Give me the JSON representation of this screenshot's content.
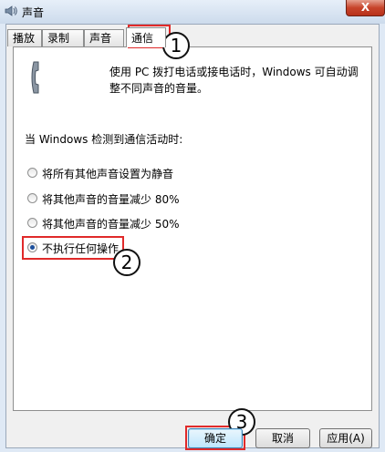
{
  "window": {
    "title": "声音",
    "close_label": "X"
  },
  "tabs": [
    {
      "label": "播放",
      "active": false
    },
    {
      "label": "录制",
      "active": false
    },
    {
      "label": "声音",
      "active": false
    },
    {
      "label": "通信",
      "active": true
    }
  ],
  "communications": {
    "description": "使用 PC 拨打电话或接电话时，Windows 可自动调整不同声音的音量。",
    "group_label": "当 Windows 检测到通信活动时:",
    "options": [
      {
        "label": "将所有其他声音设置为静音",
        "checked": false
      },
      {
        "label": "将其他声音的音量减少 80%",
        "checked": false
      },
      {
        "label": "将其他声音的音量减少 50%",
        "checked": false
      },
      {
        "label": "不执行任何操作",
        "checked": true
      }
    ]
  },
  "buttons": {
    "ok": "确定",
    "cancel": "取消",
    "apply": "应用(A)"
  },
  "callouts": [
    "1",
    "2",
    "3"
  ],
  "colors": {
    "highlight": "#e02a2a",
    "accent": "#1c4f9c"
  }
}
